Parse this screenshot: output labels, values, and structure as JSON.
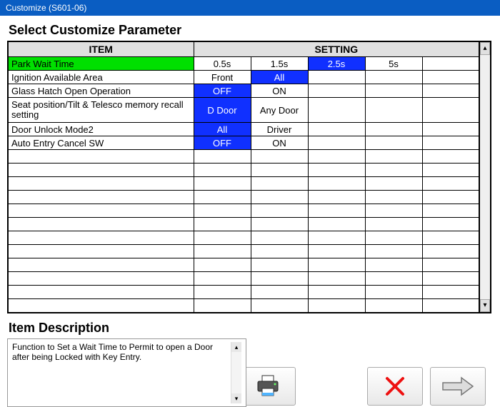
{
  "window": {
    "title": "Customize (S601-06)"
  },
  "grid": {
    "section_title": "Select Customize Parameter",
    "headers": {
      "item": "ITEM",
      "setting": "SETTING"
    },
    "setting_cols": 5,
    "total_rows": 18,
    "rows": [
      {
        "item": "Park Wait Time",
        "item_selected": true,
        "cells": [
          {
            "v": "0.5s"
          },
          {
            "v": "1.5s"
          },
          {
            "v": "2.5s",
            "sel": true
          },
          {
            "v": "5s"
          },
          {
            "v": ""
          }
        ]
      },
      {
        "item": "Ignition Available Area",
        "cells": [
          {
            "v": "Front"
          },
          {
            "v": "All",
            "sel": true
          },
          {
            "v": ""
          },
          {
            "v": ""
          },
          {
            "v": ""
          }
        ]
      },
      {
        "item": "Glass Hatch Open Operation",
        "cells": [
          {
            "v": "OFF",
            "sel": true
          },
          {
            "v": "ON"
          },
          {
            "v": ""
          },
          {
            "v": ""
          },
          {
            "v": ""
          }
        ]
      },
      {
        "item": "Seat position/Tilt & Telesco memory recall setting",
        "tall": true,
        "cells": [
          {
            "v": "D Door",
            "sel": true
          },
          {
            "v": "Any Door"
          },
          {
            "v": ""
          },
          {
            "v": ""
          },
          {
            "v": ""
          }
        ]
      },
      {
        "item": "Door Unlock Mode2",
        "cells": [
          {
            "v": "All",
            "sel": true
          },
          {
            "v": "Driver"
          },
          {
            "v": ""
          },
          {
            "v": ""
          },
          {
            "v": ""
          }
        ]
      },
      {
        "item": "Auto Entry Cancel SW",
        "cells": [
          {
            "v": "OFF",
            "sel": true
          },
          {
            "v": "ON"
          },
          {
            "v": ""
          },
          {
            "v": ""
          },
          {
            "v": ""
          }
        ]
      }
    ]
  },
  "description": {
    "title": "Item Description",
    "text": "Function to Set a Wait Time to Permit to open a Door after being Locked with Key Entry."
  },
  "buttons": {
    "print": "print-icon",
    "cancel": "cancel-icon",
    "next": "next-icon"
  },
  "glyphs": {
    "up": "▴",
    "down": "▾"
  }
}
